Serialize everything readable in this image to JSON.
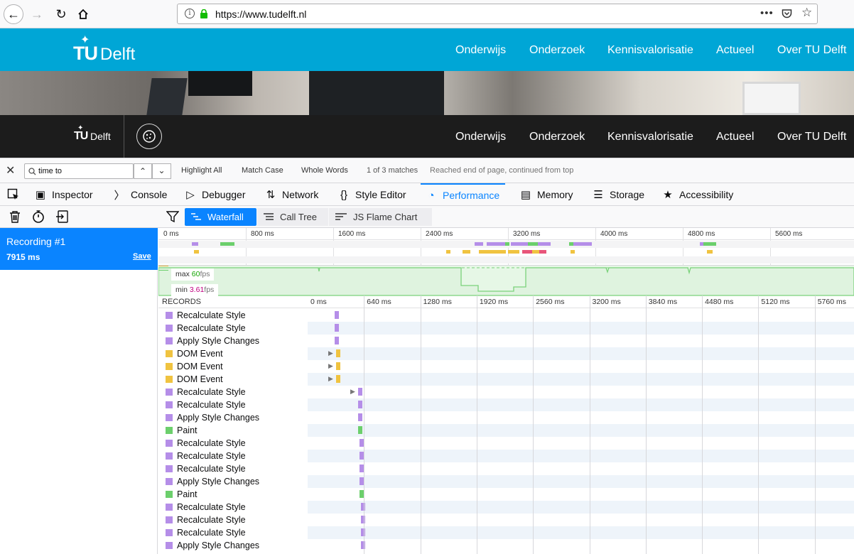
{
  "browser": {
    "url": "https://www.tudelft.nl",
    "icons": [
      "back-icon",
      "forward-icon",
      "reload-icon",
      "home-icon",
      "info-icon",
      "lock-icon",
      "more-icon",
      "pocket-icon",
      "bookmark-star-icon"
    ]
  },
  "site": {
    "logo_tu": "TU",
    "logo_delft": "Delft",
    "nav": [
      "Onderwijs",
      "Onderzoek",
      "Kennisvalorisatie",
      "Actueel",
      "Over TU Delft"
    ]
  },
  "findbar": {
    "query": "time to",
    "highlight_all": "Highlight All",
    "match_case": "Match Case",
    "whole_words": "Whole Words",
    "matches": "1 of 3 matches",
    "status": "Reached end of page, continued from top"
  },
  "devtools": {
    "tabs": [
      {
        "label": "Inspector",
        "icon": "inspector-icon"
      },
      {
        "label": "Console",
        "icon": "console-icon"
      },
      {
        "label": "Debugger",
        "icon": "debugger-icon"
      },
      {
        "label": "Network",
        "icon": "network-icon"
      },
      {
        "label": "Style Editor",
        "icon": "style-editor-icon"
      },
      {
        "label": "Performance",
        "icon": "performance-icon"
      },
      {
        "label": "Memory",
        "icon": "memory-icon"
      },
      {
        "label": "Storage",
        "icon": "storage-icon"
      },
      {
        "label": "Accessibility",
        "icon": "accessibility-icon"
      }
    ],
    "active_tab": "Performance"
  },
  "perf": {
    "views": [
      "Waterfall",
      "Call Tree",
      "JS Flame Chart"
    ],
    "active_view": "Waterfall",
    "recording": {
      "name": "Recording #1",
      "duration": "7915 ms",
      "save": "Save"
    },
    "overview_ticks": [
      "0 ms",
      "800 ms",
      "1600 ms",
      "2400 ms",
      "3200 ms",
      "4000 ms",
      "4800 ms",
      "5600 ms"
    ],
    "fps": {
      "max_label": "max",
      "max_value": "60",
      "min_label": "min",
      "min_value": "3.61",
      "unit": "fps"
    },
    "records_header": "RECORDS",
    "records_ticks": [
      "0 ms",
      "640 ms",
      "1280 ms",
      "1920 ms",
      "2560 ms",
      "3200 ms",
      "3840 ms",
      "4480 ms",
      "5120 ms",
      "5760 ms"
    ],
    "colors": {
      "style": "#b58ee8",
      "dom": "#f0c340",
      "paint": "#6ccf6c",
      "gc": "#e8557a"
    },
    "records": [
      {
        "label": "Recalculate Style",
        "type": "style"
      },
      {
        "label": "Recalculate Style",
        "type": "style"
      },
      {
        "label": "Apply Style Changes",
        "type": "style"
      },
      {
        "label": "DOM Event",
        "type": "dom"
      },
      {
        "label": "DOM Event",
        "type": "dom"
      },
      {
        "label": "DOM Event",
        "type": "dom"
      },
      {
        "label": "Recalculate Style",
        "type": "style"
      },
      {
        "label": "Recalculate Style",
        "type": "style"
      },
      {
        "label": "Apply Style Changes",
        "type": "style"
      },
      {
        "label": "Paint",
        "type": "paint"
      },
      {
        "label": "Recalculate Style",
        "type": "style"
      },
      {
        "label": "Recalculate Style",
        "type": "style"
      },
      {
        "label": "Recalculate Style",
        "type": "style"
      },
      {
        "label": "Apply Style Changes",
        "type": "style"
      },
      {
        "label": "Paint",
        "type": "paint"
      },
      {
        "label": "Recalculate Style",
        "type": "style"
      },
      {
        "label": "Recalculate Style",
        "type": "style"
      },
      {
        "label": "Recalculate Style",
        "type": "style"
      },
      {
        "label": "Apply Style Changes",
        "type": "style"
      }
    ]
  }
}
